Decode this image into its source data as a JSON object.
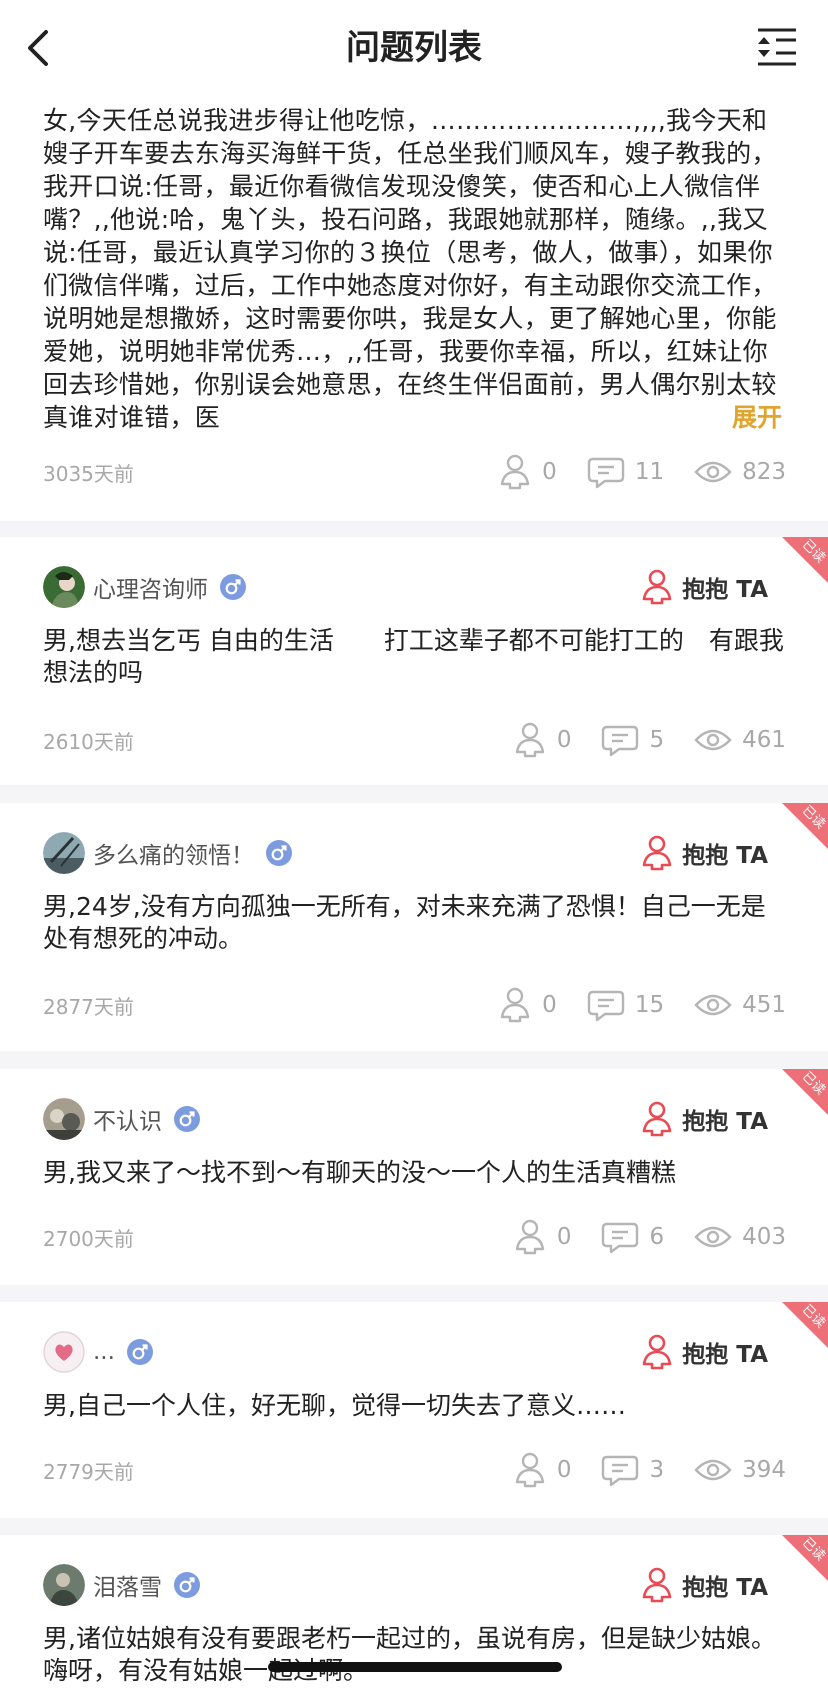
{
  "header": {
    "title": "问题列表"
  },
  "first_post": {
    "text": "女,今天任总说我进步得让他吃惊，……………………,,,,我今天和嫂子开车要去东海买海鲜干货，任总坐我们顺风车，嫂子教我的，我开口说:任哥，最近你看微信发现没傻笑，使否和心上人微信伴嘴？,,他说:哈，鬼丫头，投石问路，我跟她就那样，随缘。,,我又说:任哥，最近认真学习你的３换位（思考，做人，做事），如果你们微信伴嘴，过后，工作中她态度对你好，有主动跟你交流工作，说明她是想撒娇，这时需要你哄，我是女人，更了解她心里，你能爱她，说明她非常优秀…，,,任哥，我要你幸福，所以，红妹让你回去珍惜她，你别误会她意思，在终生伴侣面前，男人偶尔别太较真谁对谁错，医",
    "expand_label": "展开",
    "time": "3035天前",
    "hugs": "0",
    "comments": "11",
    "views": "823"
  },
  "hug_label": "抱抱 TA",
  "ribbon_label": "已读",
  "posts": [
    {
      "user": "心理咨询师",
      "avatar_color": "#3b6b35",
      "text": "男,想去当乞丐 自由的生活　　打工这辈子都不可能打工的　有跟我想法的吗",
      "time": "2610天前",
      "hugs": "0",
      "comments": "5",
      "views": "461"
    },
    {
      "user": "多么痛的领悟！",
      "avatar_color": "#4b5d63",
      "text": "男,24岁,没有方向孤独一无所有，对未来充满了恐惧！自己一无是处有想死的冲动。",
      "time": "2877天前",
      "hugs": "0",
      "comments": "15",
      "views": "451"
    },
    {
      "user": "不认识",
      "avatar_color": "#7a7a72",
      "text": "男,我又来了～找不到～有聊天的没～一个人的生活真糟糕",
      "time": "2700天前",
      "hugs": "0",
      "comments": "6",
      "views": "403"
    },
    {
      "user": "...",
      "avatar_color": "#f3e8ec",
      "text": "男,自己一个人住，好无聊，觉得一切失去了意义……",
      "time": "2779天前",
      "hugs": "0",
      "comments": "3",
      "views": "394"
    },
    {
      "user": "泪落雪",
      "avatar_color": "#6d7b6f",
      "text": "男,诸位姑娘有没有要跟老朽一起过的，虽说有房，但是缺少姑娘。嗨呀，有没有姑娘一起过啊。",
      "time": "",
      "hugs": "",
      "comments": "",
      "views": ""
    }
  ],
  "colors": {
    "accent_red": "#e94b55",
    "expand_gold": "#e0a530",
    "gender_blue": "#7d9ce0",
    "muted": "#a8a8a8"
  }
}
